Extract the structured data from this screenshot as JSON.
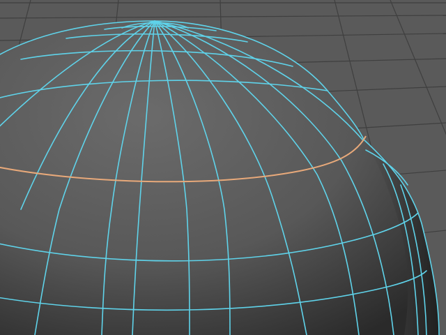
{
  "viewport": {
    "background_color": "#5a5a5a",
    "grid_color": "#3f3f3f",
    "wire_color": "#5fd3ea",
    "selected_edge_color": "#e8a97a"
  },
  "object": {
    "type": "polygon-sphere-wireframe",
    "selected_edge_loop": "horizontal-loop"
  }
}
